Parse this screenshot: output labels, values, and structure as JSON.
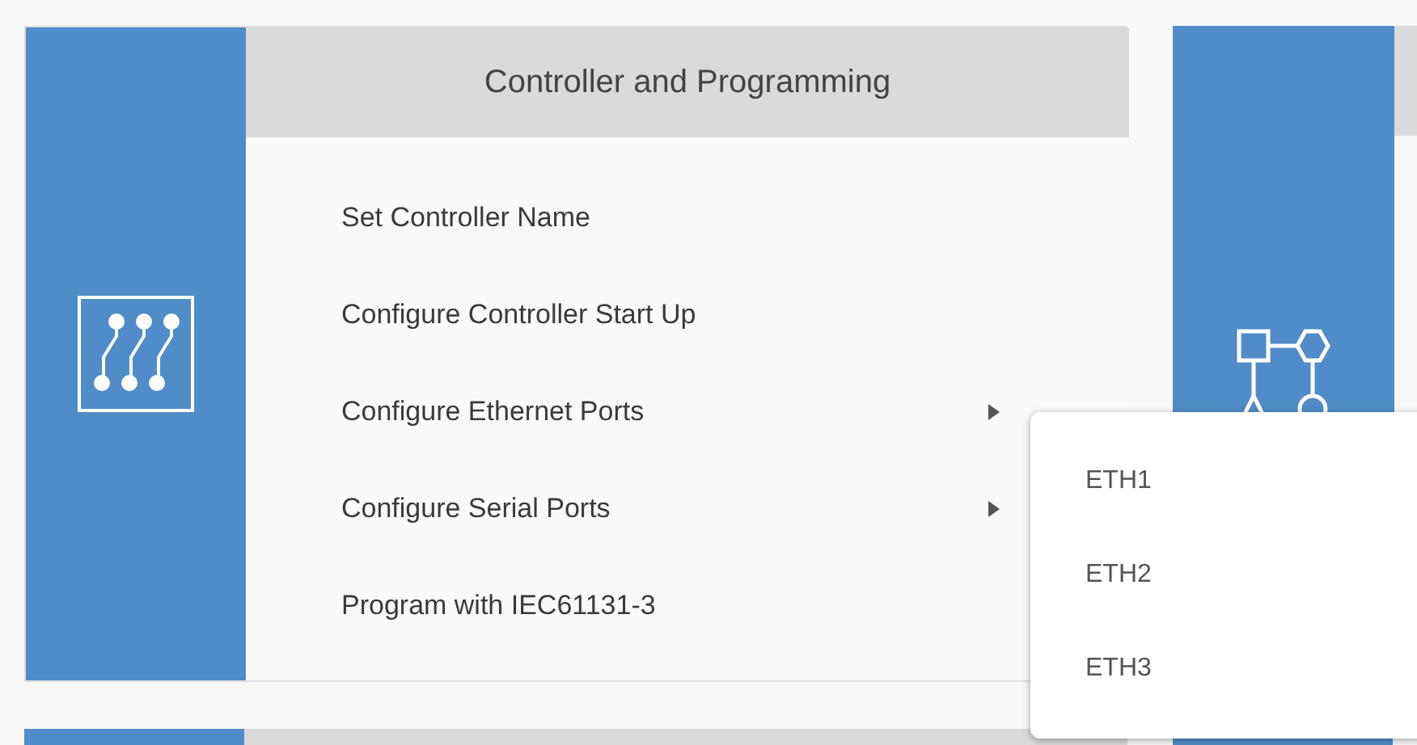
{
  "card": {
    "title": "Controller and Programming",
    "items": [
      {
        "label": "Set Controller Name",
        "has_submenu": false
      },
      {
        "label": "Configure Controller Start Up",
        "has_submenu": false
      },
      {
        "label": "Configure Ethernet Ports",
        "has_submenu": true
      },
      {
        "label": "Configure Serial Ports",
        "has_submenu": true
      },
      {
        "label": "Program with IEC61131-3",
        "has_submenu": false
      }
    ]
  },
  "submenu": {
    "items": [
      "ETH1",
      "ETH2",
      "ETH3"
    ]
  }
}
